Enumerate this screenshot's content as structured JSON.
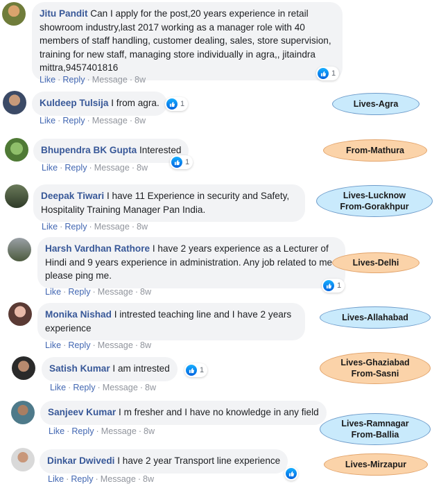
{
  "actions": {
    "like": "Like",
    "reply": "Reply",
    "message": "Message",
    "time": "8w",
    "sep": "·"
  },
  "colors": {
    "name": "#385898",
    "link": "#4267b2",
    "muted": "#90949c",
    "bubble": "#f2f3f5",
    "tag_blue": "#c9eafc",
    "tag_orange": "#fbd3a9"
  },
  "comments": [
    {
      "name": "Jitu Pandit",
      "text": "Can I apply for the post,20 years experience in retail showroom industry,last 2017 working as a manager role with 40 members of staff handling, customer dealing, sales, store supervision, training for new staff, managing store individually in agra,, jitaindra mittra,9457401816",
      "reactions": "1",
      "tag": []
    },
    {
      "name": "Kuldeep Tulsija",
      "text": "I from agra.",
      "reactions": "1",
      "tag": [
        "Lives-Agra"
      ]
    },
    {
      "name": "Bhupendra BK Gupta",
      "text": "Interested",
      "reactions": "1",
      "tag": [
        "From-Mathura"
      ]
    },
    {
      "name": "Deepak Tiwari",
      "text": "I have 11 Experience in security and Safety, Hospitality Training Manager Pan India.",
      "reactions": "",
      "tag": [
        "Lives-Lucknow",
        "From-Gorakhpur"
      ]
    },
    {
      "name": "Harsh Vardhan Rathore",
      "text": "I have 2 years experience as a Lecturer of Hindi and 9 years experience in administration. Any job related to me please ping me.",
      "reactions": "1",
      "tag": [
        "Lives-Delhi"
      ]
    },
    {
      "name": "Monika Nishad",
      "text": "I intrested teaching line and I have 2 years experience",
      "reactions": "",
      "tag": [
        "Lives-Allahabad"
      ]
    },
    {
      "name": "Satish Kumar",
      "text": "I am intrested",
      "reactions": "1",
      "tag": [
        "Lives-Ghaziabad",
        "From-Sasni"
      ]
    },
    {
      "name": "Sanjeev Kumar",
      "text": "I m fresher and I have no knowledge in any field",
      "reactions": "",
      "tag": [
        "Lives-Ramnagar",
        "From-Ballia"
      ]
    },
    {
      "name": "Dinkar Dwivedi",
      "text": "I have 2 year Transport line experience",
      "reactions": "",
      "tag": [
        "Lives-Mirzapur"
      ]
    }
  ],
  "icons": {
    "like": "thumbs-up-icon",
    "avatar": "avatar"
  }
}
